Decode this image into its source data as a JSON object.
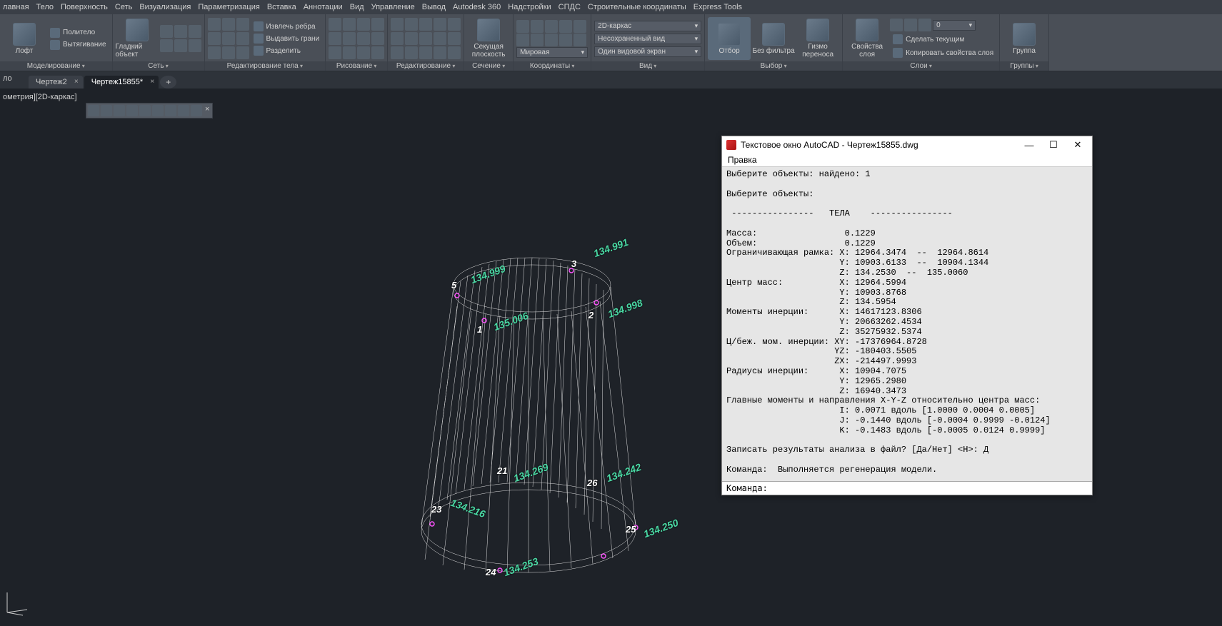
{
  "menu": [
    "лавная",
    "Тело",
    "Поверхность",
    "Сеть",
    "Визуализация",
    "Параметризация",
    "Вставка",
    "Аннотации",
    "Вид",
    "Управление",
    "Вывод",
    "Autodesk 360",
    "Надстройки",
    "СПДС",
    "Строительные координаты",
    "Express Tools"
  ],
  "ribbon": {
    "modeling": {
      "label": "Моделирование",
      "big": "Лофт",
      "items": [
        "Политело",
        "Вытягивание"
      ]
    },
    "mesh": {
      "label": "Сеть",
      "big": "Гладкий объект"
    },
    "solid_edit": {
      "label": "Редактирование тела",
      "items": [
        "Извлечь ребра",
        "Выдавить грани",
        "Разделить"
      ]
    },
    "drawing": {
      "label": "Рисование"
    },
    "editing": {
      "label": "Редактирование"
    },
    "section": {
      "label": "Сечение",
      "big": "Секущая плоскость"
    },
    "coords": {
      "label": "Координаты",
      "wcs": "Мировая"
    },
    "view": {
      "label": "Вид",
      "visual_style": "2D-каркас",
      "view_preset": "Несохраненный вид",
      "viewport": "Один видовой экран"
    },
    "select": {
      "label": "Выбор",
      "big1": "Отбор",
      "big2": "Без фильтра",
      "big3": "Гизмо переноса"
    },
    "layers": {
      "label": "Слои",
      "big": "Свойства слоя",
      "zero": "0",
      "btn1": "Сделать текущим",
      "btn2": "Копировать свойства слоя"
    },
    "groups": {
      "label": "Группы",
      "big": "Группа"
    }
  },
  "tabs": {
    "left": "ло",
    "tab1": "Чертеж2",
    "tab2": "Чертеж15855*"
  },
  "viewport_label": "ометрия][2D-каркас]",
  "annotations": {
    "dims": {
      "d1": "134.999",
      "d2": "134.991",
      "d3": "134.998",
      "d4": "135.006",
      "d5": "134.242",
      "d6": "134.250",
      "d7": "134.253",
      "d8": "134.269",
      "d9": "134.216"
    },
    "pts": {
      "p1": "1",
      "p2": "2",
      "p3": "3",
      "p5": "5",
      "p21": "21",
      "p23": "23",
      "p24": "24",
      "p25": "25",
      "p26": "26"
    }
  },
  "textwin": {
    "title": "Текстовое окно AutoCAD - Чертеж15855.dwg",
    "menu": "Правка",
    "body": "Выберите объекты: найдено: 1\n\nВыберите объекты:\n\n ----------------   ТЕЛА    ----------------\n\nМасса:                 0.1229\nОбъем:                 0.1229\nОграничивающая рамка: X: 12964.3474  --  12964.8614\n                      Y: 10903.6133  --  10904.1344\n                      Z: 134.2530  --  135.0060\nЦентр масс:           X: 12964.5994\n                      Y: 10903.8768\n                      Z: 134.5954\nМоменты инерции:      X: 14617123.8306\n                      Y: 20663262.4534\n                      Z: 35275932.5374\nЦ/беж. мом. инерции: XY: -17376964.8728\n                     YZ: -180403.5505\n                     ZX: -214497.9993\nРадиусы инерции:      X: 10904.7075\n                      Y: 12965.2980\n                      Z: 16940.3473\nГлавные моменты и направления X-Y-Z относительно центра масс:\n                      I: 0.0071 вдоль [1.0000 0.0004 0.0005]\n                      J: -0.1440 вдоль [-0.0004 0.9999 -0.0124]\n                      K: -0.1483 вдоль [-0.0005 0.0124 0.9999]\n\nЗаписать результаты анализа в файл? [Да/Нет] <Н>: Д\n\nКоманда:  Выполняется регенерация модели.\n",
    "cmd_label": "Команда:"
  }
}
